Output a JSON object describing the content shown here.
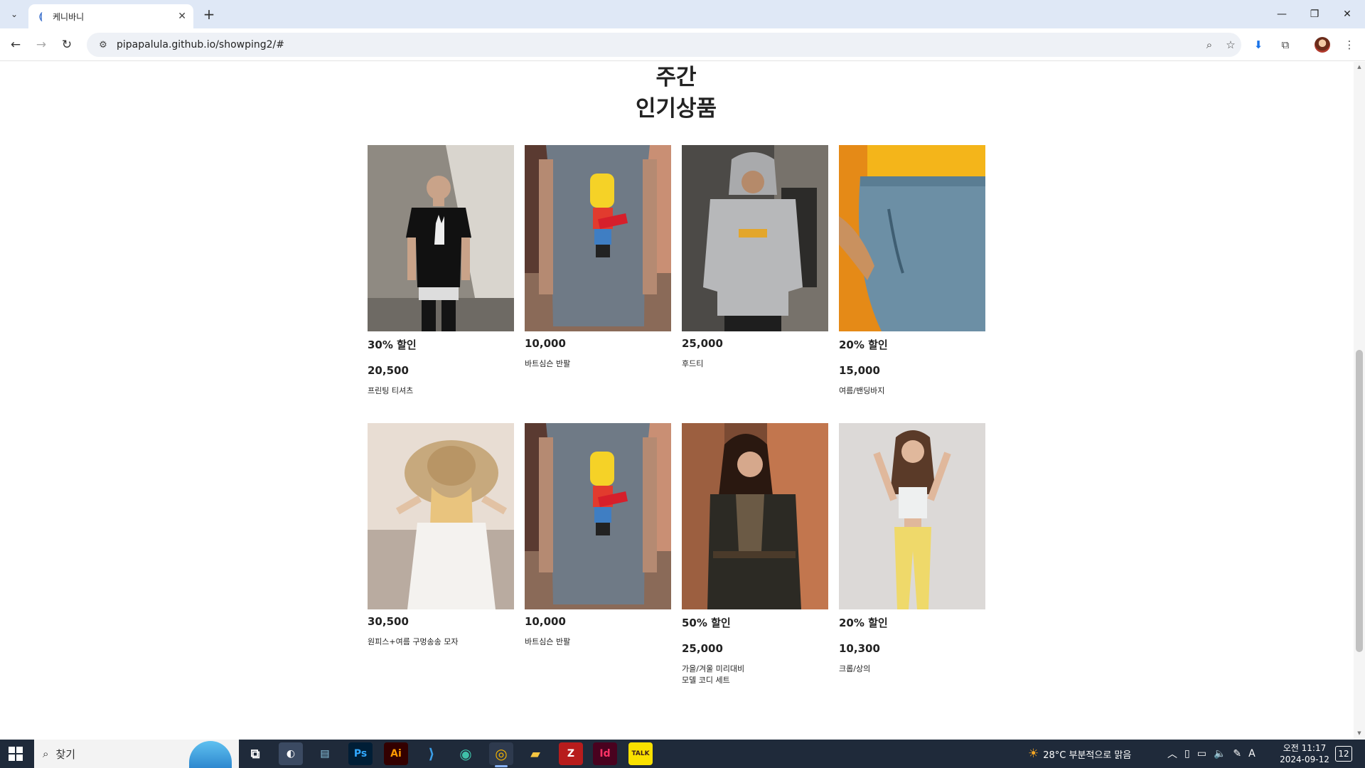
{
  "browser": {
    "tab_title": "케니바니",
    "url": "pipapalula.github.io/showping2/#"
  },
  "page": {
    "heading_line1": "주간",
    "heading_line2": "인기상품",
    "products": [
      {
        "tag": "30% 할인",
        "price": "20,500",
        "name": "프린팅 티셔츠",
        "image": "man-black-peace-tshirt"
      },
      {
        "tag": "",
        "price": "10,000",
        "name": "바트심슨 반팔",
        "image": "bart-simpson-tshirt"
      },
      {
        "tag": "",
        "price": "25,000",
        "name": "후드티",
        "image": "grey-hoodie"
      },
      {
        "tag": "20% 할인",
        "price": "15,000",
        "name": "여름/밴딩바지",
        "image": "blue-banding-pants"
      },
      {
        "tag": "",
        "price": "30,500",
        "name": "원피스+여름 구멍송송 모자",
        "image": "straw-hat-dress"
      },
      {
        "tag": "",
        "price": "10,000",
        "name": "바트심슨 반팔",
        "image": "bart-simpson-tshirt"
      },
      {
        "tag": "50% 할인",
        "price": "25,000",
        "name": "가을/겨울 미리대비\n모델 코디 세트",
        "image": "woman-leather-jacket"
      },
      {
        "tag": "20% 할인",
        "price": "10,300",
        "name": "크롭/상의",
        "image": "woman-yellow-pants"
      }
    ]
  },
  "taskbar": {
    "search_placeholder": "찾기",
    "weather": "28°C  부분적으로 맑음",
    "time": "오전 11:17",
    "date": "2024-09-12",
    "notifications": "12",
    "ime": "A",
    "apps": [
      "Ps",
      "Ai",
      "Id",
      "TALK"
    ]
  }
}
